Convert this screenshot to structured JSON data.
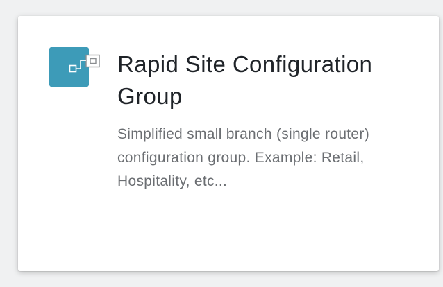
{
  "card": {
    "icon": "configuration-group-icon",
    "icon_color": "#3d9bb8",
    "title": "Rapid Site Configuration Group",
    "description": "Simplified small branch (single router) configuration group. Example: Retail, Hospitality, etc..."
  }
}
